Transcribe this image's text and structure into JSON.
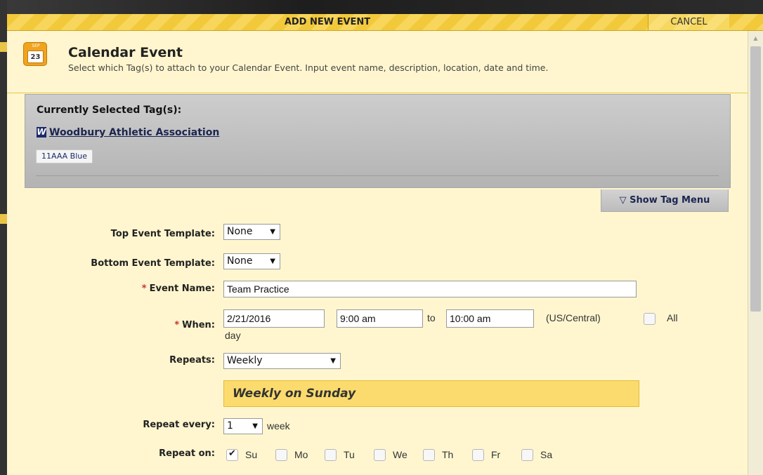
{
  "modal": {
    "title": "ADD NEW EVENT",
    "cancel_label": "CANCEL"
  },
  "header": {
    "icon_month": "SEP",
    "icon_day": "23",
    "title": "Calendar Event",
    "description": "Select which Tag(s) to attach to your Calendar Event. Input event name, description, location, date and time."
  },
  "tags": {
    "heading": "Currently Selected Tag(s):",
    "org_logo_letter": "W",
    "org_name": "Woodbury Athletic Association",
    "chips": [
      "11AAA Blue"
    ]
  },
  "show_tag_menu_label": "▽ Show Tag Menu",
  "form": {
    "top_template": {
      "label": "Top Event Template:",
      "value": "None"
    },
    "bottom_template": {
      "label": "Bottom Event Template:",
      "value": "None"
    },
    "event_name": {
      "label": "Event Name:",
      "value": "Team Practice"
    },
    "when": {
      "label": "When:",
      "date": "2/21/2016",
      "start_time": "9:00 am",
      "to_label": "to",
      "end_time": "10:00 am",
      "timezone": "(US/Central)",
      "all_day_label_1": "All",
      "all_day_label_2": "day"
    },
    "repeats": {
      "label": "Repeats:",
      "value": "Weekly"
    },
    "summary": "Weekly on Sunday",
    "repeat_every": {
      "label": "Repeat every:",
      "value": "1",
      "unit": "week"
    },
    "repeat_on": {
      "label": "Repeat on:",
      "days": [
        {
          "label": "Su",
          "checked": true
        },
        {
          "label": "Mo",
          "checked": false
        },
        {
          "label": "Tu",
          "checked": false
        },
        {
          "label": "We",
          "checked": false
        },
        {
          "label": "Th",
          "checked": false
        },
        {
          "label": "Fr",
          "checked": false
        },
        {
          "label": "Sa",
          "checked": false
        }
      ]
    }
  },
  "colors": {
    "titlebar": "#f2c93a",
    "modal_bg": "#fff6cf",
    "tag_panel": "#c4c4c4",
    "summary_bg": "#fbdb6d",
    "required": "#d03030",
    "link": "#1b2550"
  },
  "icons": {
    "calendar": "calendar-icon",
    "dropdown": "chevron-down-icon",
    "scroll_up": "scroll-up-arrow-icon",
    "show_menu": "triangle-down-icon"
  }
}
